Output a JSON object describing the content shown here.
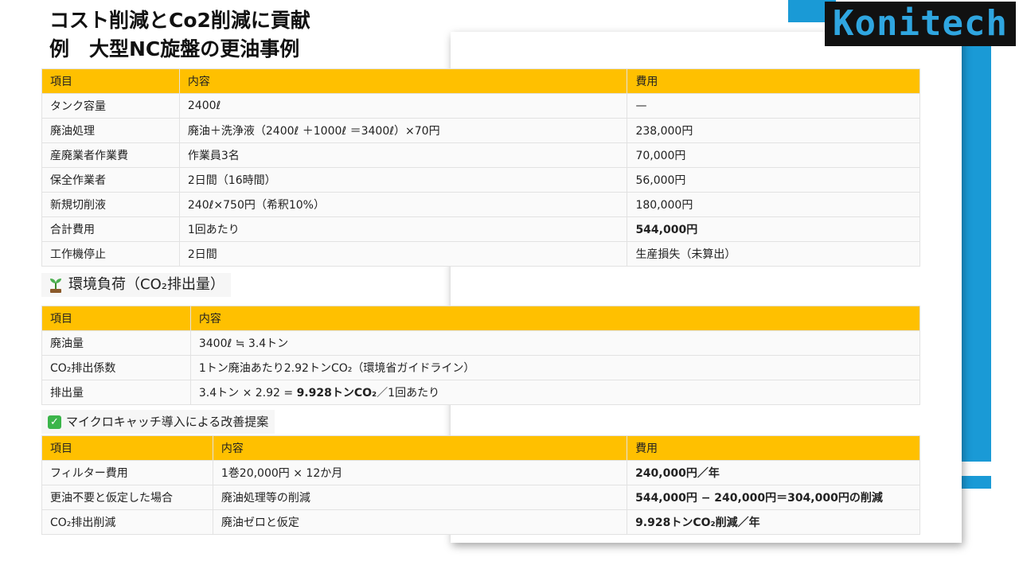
{
  "title": {
    "line1": "コスト削減とCo2削減に貢献",
    "line2": "例　大型NC旋盤の更油事例"
  },
  "logo": {
    "text": "Konitech"
  },
  "colors": {
    "header": "#ffc000",
    "accent_blue": "#1a9ad6"
  },
  "table1": {
    "headers": [
      "項目",
      "内容",
      "費用"
    ],
    "rows": [
      [
        "タンク容量",
        "2400ℓ",
        "—"
      ],
      [
        "廃油処理",
        "廃油＋洗浄液（2400ℓ ＋1000ℓ ＝3400ℓ）×70円",
        "238,000円"
      ],
      [
        "産廃業者作業費",
        "作業員3名",
        "70,000円"
      ],
      [
        "保全作業者",
        "2日間（16時間）",
        "56,000円"
      ],
      [
        "新規切削液",
        "240ℓ×750円（希釈10%）",
        "180,000円"
      ],
      [
        "合計費用",
        "1回あたり",
        "544,000円"
      ],
      [
        "工作機停止",
        "2日間",
        "生産損失（未算出）"
      ]
    ]
  },
  "section1": {
    "icon": "sprout-icon",
    "label": "環境負荷（CO₂排出量）"
  },
  "table2": {
    "headers": [
      "項目",
      "内容"
    ],
    "rows": [
      [
        "廃油量",
        "3400ℓ ≒ 3.4トン"
      ],
      [
        "CO₂排出係数",
        "1トン廃油あたり2.92トンCO₂（環境省ガイドライン）"
      ],
      [
        "排出量",
        "3.4トン × 2.92 = ",
        "9.928トンCO₂",
        "／1回あたり"
      ]
    ]
  },
  "section2": {
    "icon": "check-icon",
    "label": "マイクロキャッチ導入による改善提案"
  },
  "table3": {
    "headers": [
      "項目",
      "内容",
      "費用"
    ],
    "rows": [
      [
        "フィルター費用",
        "1巻20,000円 × 12か月",
        "240,000円／年"
      ],
      [
        "更油不要と仮定した場合",
        "廃油処理等の削減",
        "544,000円 − 240,000円＝304,000円の削減"
      ],
      [
        "CO₂排出削減",
        "廃油ゼロと仮定",
        "9.928トンCO₂削減／年"
      ]
    ]
  }
}
